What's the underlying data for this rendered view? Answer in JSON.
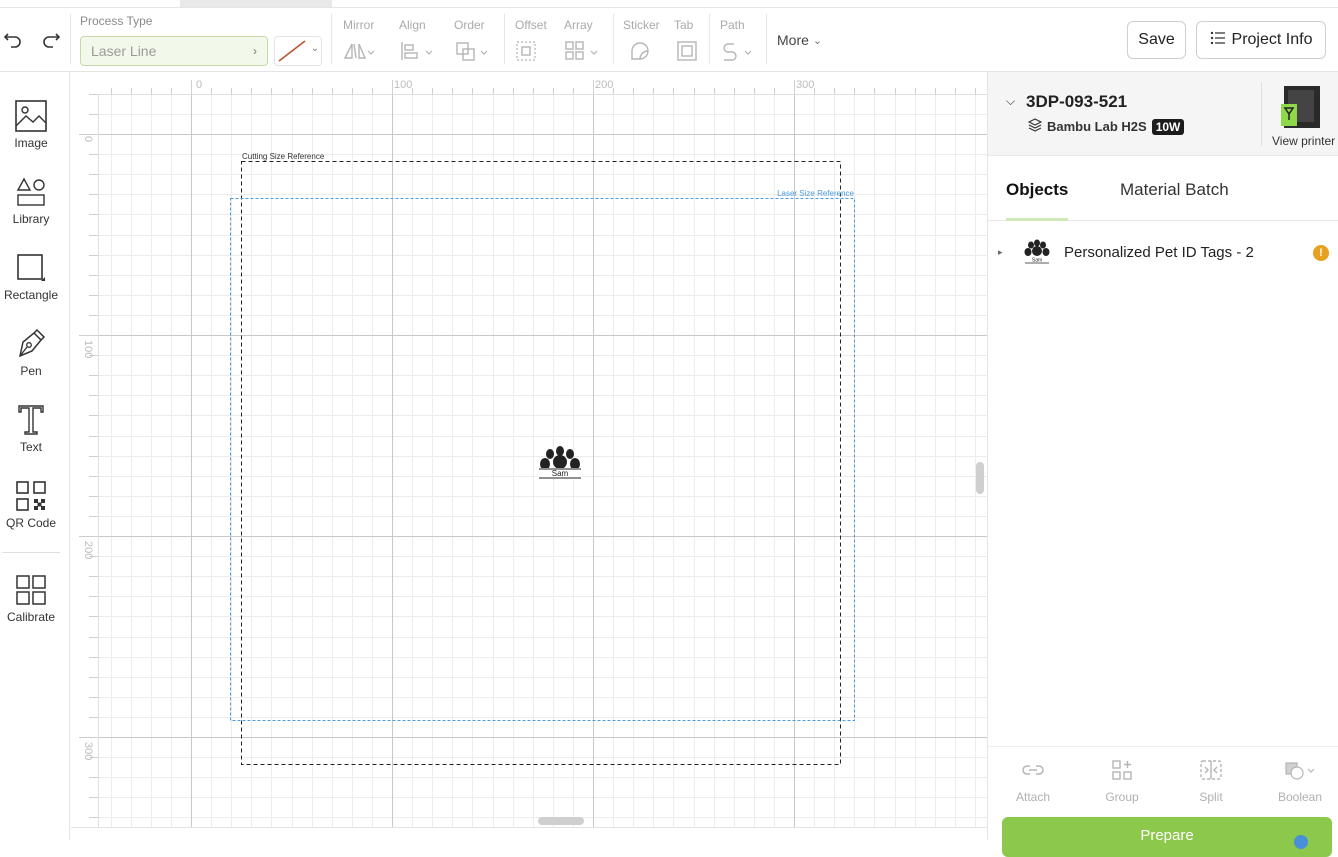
{
  "toolbar": {
    "process_type_label": "Process Type",
    "process_type_value": "Laser Line",
    "line_color": "#b5552f",
    "groups": [
      {
        "label": "Mirror",
        "icon": "mirror-icon"
      },
      {
        "label": "Align",
        "icon": "align-icon"
      },
      {
        "label": "Order",
        "icon": "order-icon"
      },
      {
        "label": "Offset",
        "icon": "offset-icon"
      },
      {
        "label": "Array",
        "icon": "array-icon"
      },
      {
        "label": "Sticker",
        "icon": "sticker-icon"
      },
      {
        "label": "Tab",
        "icon": "tab-icon"
      },
      {
        "label": "Path",
        "icon": "path-icon"
      }
    ],
    "more_label": "More",
    "save_label": "Save",
    "project_info_label": "Project Info"
  },
  "sidebar": {
    "tools": [
      {
        "label": "Image",
        "icon": "image-icon"
      },
      {
        "label": "Library",
        "icon": "library-icon"
      },
      {
        "label": "Rectangle",
        "icon": "rectangle-icon"
      },
      {
        "label": "Pen",
        "icon": "pen-icon"
      },
      {
        "label": "Text",
        "icon": "text-icon"
      },
      {
        "label": "QR Code",
        "icon": "qr-code-icon"
      },
      {
        "label": "Calibrate",
        "icon": "calibrate-icon"
      }
    ]
  },
  "canvas": {
    "ruler_x_labels": [
      "0",
      "100",
      "200",
      "300"
    ],
    "ruler_y_labels": [
      "0",
      "100",
      "200",
      "300"
    ],
    "cutting_ref_label": "Cutting Size Reference",
    "laser_ref_label": "Laser Size Reference",
    "object_text": "Sam",
    "laser_ref_color": "#4a9be0"
  },
  "panel": {
    "printer_id": "3DP-093-521",
    "printer_model": "Bambu Lab H2S",
    "printer_power": "10W",
    "view_printer_label": "View printer",
    "tabs": [
      {
        "label": "Objects",
        "active": true
      },
      {
        "label": "Material Batch",
        "active": false
      }
    ],
    "objects": [
      {
        "name": "Personalized Pet ID Tags - 2",
        "warning": "!"
      }
    ],
    "actions": [
      {
        "label": "Attach",
        "icon": "attach-icon"
      },
      {
        "label": "Group",
        "icon": "group-icon"
      },
      {
        "label": "Split",
        "icon": "split-icon"
      },
      {
        "label": "Boolean",
        "icon": "boolean-icon"
      }
    ],
    "prepare_label": "Prepare",
    "accent_color": "#8cc84b"
  }
}
